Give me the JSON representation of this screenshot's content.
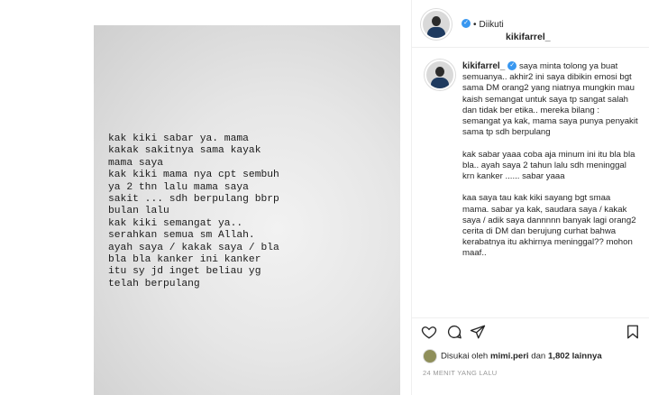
{
  "story": {
    "text": "kak kiki sabar ya. mama\nkakak sakitnya sama kayak\nmama saya\nkak kiki mama nya cpt sembuh\nya 2 thn lalu mama saya\nsakit ... sdh berpulang bbrp\nbulan lalu\nkak kiki semangat ya..\nserahkan semua sm Allah.\nayah saya / kakak saya / bla\nbla bla kanker ini kanker\nitu sy jd inget beliau yg\ntelah berpulang"
  },
  "header": {
    "username": "kikifarrel_",
    "separator": "•",
    "follow_status": "Diikuti"
  },
  "caption": {
    "username": "kikifarrel_",
    "text": "saya minta tolong ya buat semuanya.. akhir2 ini saya dibikin emosi bgt sama DM orang2 yang niatnya mungkin mau kaish semangat untuk saya tp sangat salah dan tidak ber etika.. mereka bilang :\nsemangat ya kak, mama saya punya penyakit sama tp sdh berpulang\n\nkak sabar yaaa coba aja minum ini itu bla bla bla.. ayah saya 2 tahun lalu sdh meninggal krn kanker ...... sabar yaaa\n\nkaa saya tau kak kiki sayang bgt smaa mama. sabar ya kak, saudara saya / kakak saya / adik saya dannnnn banyak lagi orang2 cerita di DM dan berujung curhat bahwa kerabatnya itu akhirnya meninggal?? mohon maaf.."
  },
  "likes": {
    "prefix": "Disukai oleh",
    "user": "mimi.peri",
    "connector": "dan",
    "count": "1,802 lainnya"
  },
  "time": "24 MENIT YANG LALU",
  "icons": [
    "heart-icon",
    "comment-icon",
    "share-icon",
    "bookmark-icon",
    "verified-icon"
  ],
  "colors": {
    "verified": "#3897f0",
    "muted": "#999999"
  }
}
